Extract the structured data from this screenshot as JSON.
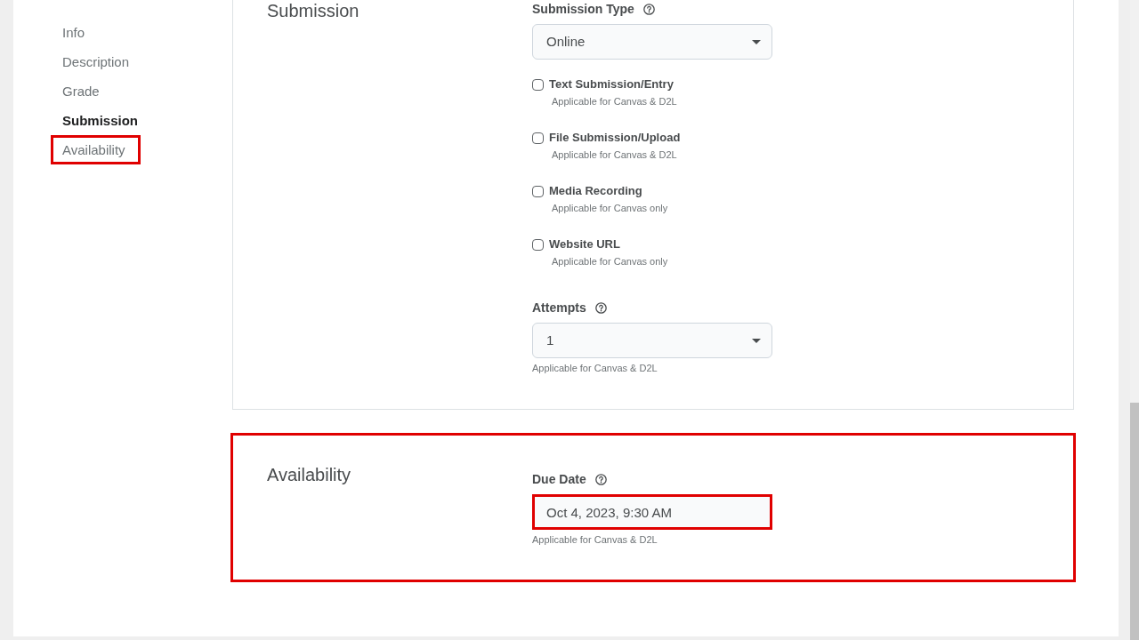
{
  "sidebar": {
    "items": [
      {
        "label": "Info",
        "selected": false,
        "highlighted": false
      },
      {
        "label": "Description",
        "selected": false,
        "highlighted": false
      },
      {
        "label": "Grade",
        "selected": false,
        "highlighted": false
      },
      {
        "label": "Submission",
        "selected": true,
        "highlighted": false
      },
      {
        "label": "Availability",
        "selected": false,
        "highlighted": true
      }
    ]
  },
  "sections": [
    {
      "title": "Submission",
      "highlighted": false,
      "fields": [
        {
          "kind": "select",
          "label": "Submission Type",
          "value": "Online",
          "highlighted": false
        },
        {
          "kind": "checkbox",
          "label": "Text Submission/Entry",
          "checked": false,
          "note": "Applicable for Canvas & D2L"
        },
        {
          "kind": "checkbox",
          "label": "File Submission/Upload",
          "checked": false,
          "note": "Applicable for Canvas & D2L"
        },
        {
          "kind": "checkbox",
          "label": "Media Recording",
          "checked": false,
          "note": "Applicable for Canvas only"
        },
        {
          "kind": "checkbox",
          "label": "Website URL",
          "checked": false,
          "note": "Applicable for Canvas only"
        },
        {
          "kind": "select",
          "label": "Attempts",
          "value": "1",
          "note": "Applicable for Canvas & D2L",
          "highlighted": false
        }
      ]
    },
    {
      "title": "Availability",
      "highlighted": true,
      "fields": [
        {
          "kind": "date",
          "label": "Due Date",
          "value": "Oct 4, 2023, 9:30 AM",
          "note": "Applicable for Canvas & D2L",
          "highlighted": true
        }
      ]
    }
  ]
}
